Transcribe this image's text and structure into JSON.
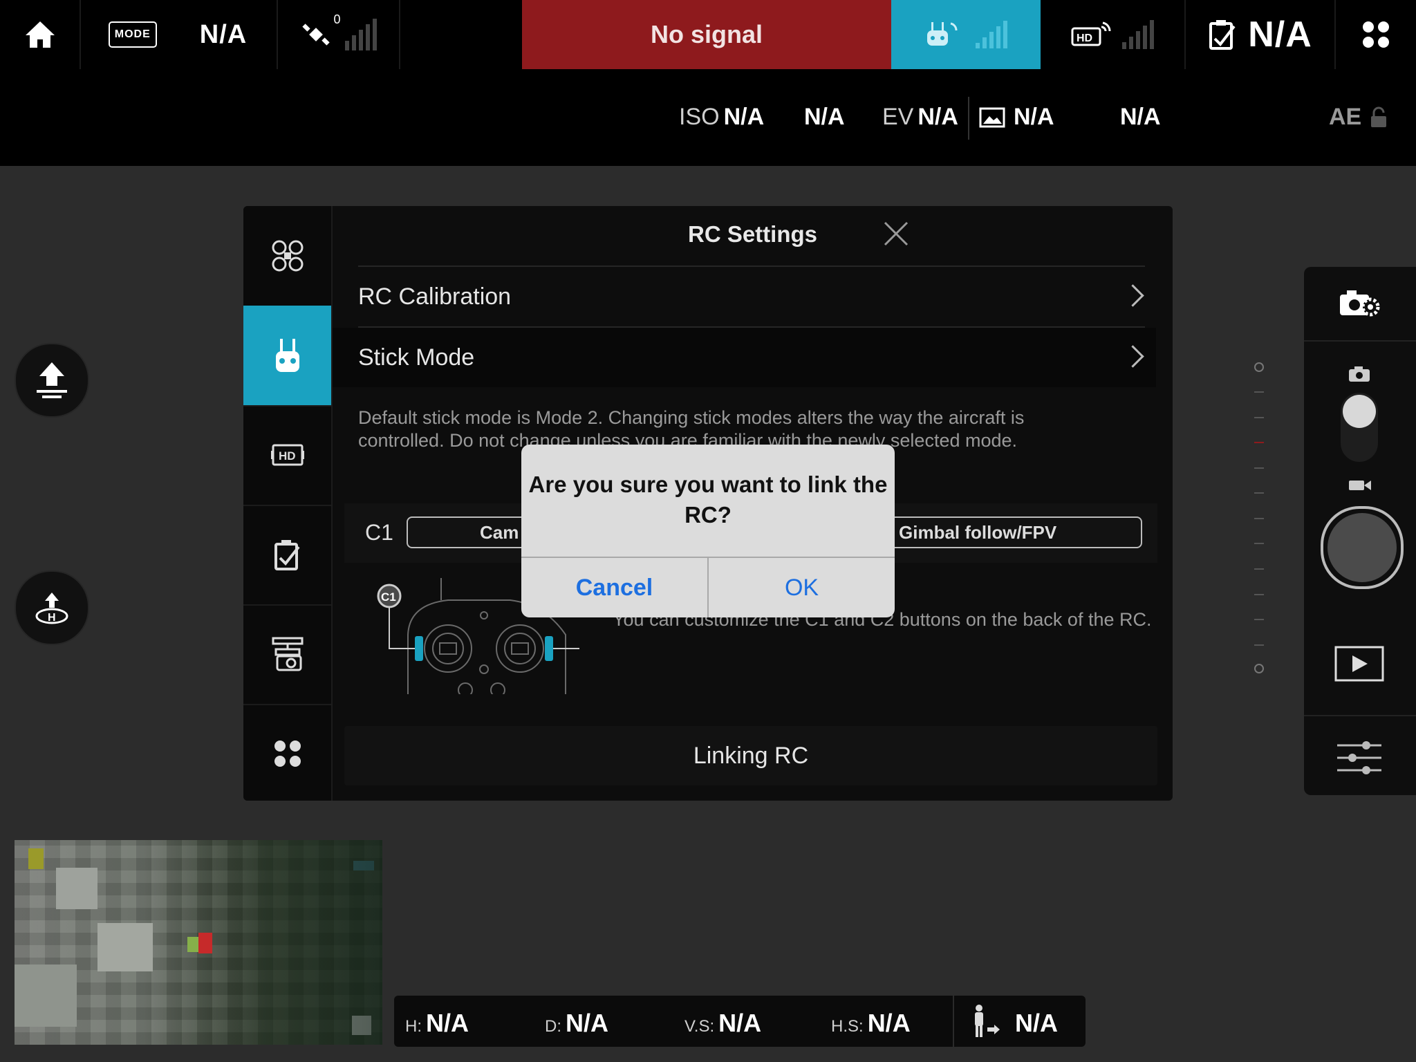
{
  "topbar": {
    "flight_mode": "N/A",
    "mode_badge": "MODE",
    "satellite_count": "0",
    "signal_status": "No signal",
    "battery": "N/A"
  },
  "camera_params": {
    "iso_label": "ISO",
    "iso_value": "N/A",
    "shutter": "N/A",
    "ev_label": "EV",
    "ev_value": "N/A",
    "format": "N/A",
    "remaining": "N/A",
    "ae_label": "AE"
  },
  "settings": {
    "title": "RC Settings",
    "rows": [
      {
        "label": "RC Calibration"
      },
      {
        "label": "Stick Mode"
      }
    ],
    "stick_mode_note": "Default stick mode is Mode 2. Changing stick modes alters the way the aircraft is controlled. Do not change unless you are familiar with the newly selected mode.",
    "c1_label": "C1",
    "c1_option_left": "Cam",
    "c1_option_right": "Gimbal follow/FPV",
    "diagram_label": "C1",
    "customize_note": "You can customize the C1 and C2 buttons on the back of the RC.",
    "link_button": "Linking RC"
  },
  "alert": {
    "message": "Are you sure you want to link the RC?",
    "cancel": "Cancel",
    "ok": "OK"
  },
  "telemetry": {
    "h_label": "H:",
    "h_value": "N/A",
    "d_label": "D:",
    "d_value": "N/A",
    "vs_label": "V.S:",
    "vs_value": "N/A",
    "hs_label": "H.S:",
    "hs_value": "N/A",
    "dist_value": "N/A"
  },
  "colors": {
    "accent": "#1aa2c1",
    "no_signal_bg": "#8e1a1d",
    "ios_button_blue": "#1d6fe0"
  },
  "icons": [
    "home-icon",
    "satellite-icon",
    "rc-signal-icon",
    "hd-signal-icon",
    "battery-icon",
    "grid-menu-icon",
    "camera-settings-icon",
    "camera-icon",
    "video-icon",
    "playback-icon",
    "sliders-icon",
    "takeoff-icon",
    "return-home-icon",
    "aircraft-icon",
    "remote-controller-icon",
    "hd-icon",
    "checklist-icon",
    "gimbal-icon",
    "more-icon",
    "close-icon",
    "chevron-right-icon",
    "lock-icon",
    "photo-format-icon",
    "person-icon"
  ]
}
